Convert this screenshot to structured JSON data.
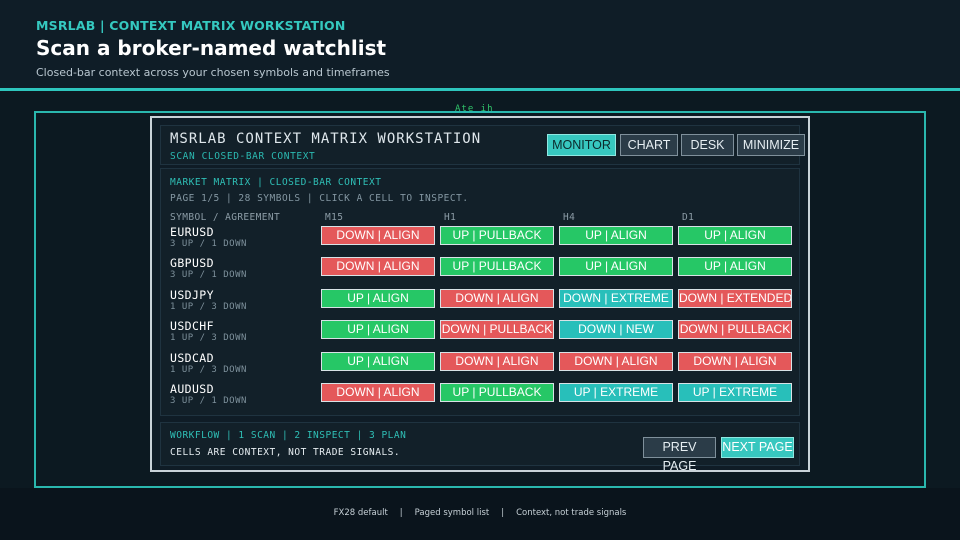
{
  "slide": {
    "brand": "MSRLAB  |  CONTEXT MATRIX WORKSTATION",
    "title": "Scan a broker-named watchlist",
    "subtitle": "Closed-bar context across your chosen symbols and timeframes",
    "ticker": "Ate ih"
  },
  "app": {
    "name": "MSRLAB  CONTEXT MATRIX WORKSTATION",
    "subtitle": "SCAN CLOSED-BAR CONTEXT",
    "buttons": [
      {
        "label": "MONITOR",
        "active": true
      },
      {
        "label": "CHART",
        "active": false
      },
      {
        "label": "DESK",
        "active": false
      },
      {
        "label": "MINIMIZE",
        "active": false
      }
    ]
  },
  "matrix": {
    "heading": "MARKET MATRIX | CLOSED-BAR CONTEXT",
    "info": "PAGE 1/5 | 28 SYMBOLS | CLICK A CELL TO INSPECT.",
    "symbol_header": "SYMBOL / AGREEMENT",
    "timeframes": [
      "M15",
      "H1",
      "H4",
      "D1"
    ],
    "rows": [
      {
        "symbol": "EURUSD",
        "agreement": "3 UP / 1 DOWN",
        "cells": [
          {
            "text": "DOWN | ALIGN",
            "color": "red"
          },
          {
            "text": "UP | PULLBACK",
            "color": "green"
          },
          {
            "text": "UP | ALIGN",
            "color": "green"
          },
          {
            "text": "UP | ALIGN",
            "color": "green"
          }
        ]
      },
      {
        "symbol": "GBPUSD",
        "agreement": "3 UP / 1 DOWN",
        "cells": [
          {
            "text": "DOWN | ALIGN",
            "color": "red"
          },
          {
            "text": "UP | PULLBACK",
            "color": "green"
          },
          {
            "text": "UP | ALIGN",
            "color": "green"
          },
          {
            "text": "UP | ALIGN",
            "color": "green"
          }
        ]
      },
      {
        "symbol": "USDJPY",
        "agreement": "1 UP / 3 DOWN",
        "cells": [
          {
            "text": "UP | ALIGN",
            "color": "green"
          },
          {
            "text": "DOWN | ALIGN",
            "color": "red"
          },
          {
            "text": "DOWN | EXTREME",
            "color": "teal"
          },
          {
            "text": "DOWN | EXTENDED",
            "color": "red"
          }
        ]
      },
      {
        "symbol": "USDCHF",
        "agreement": "1 UP / 3 DOWN",
        "cells": [
          {
            "text": "UP | ALIGN",
            "color": "green"
          },
          {
            "text": "DOWN | PULLBACK",
            "color": "red"
          },
          {
            "text": "DOWN | NEW",
            "color": "teal"
          },
          {
            "text": "DOWN | PULLBACK",
            "color": "red"
          }
        ]
      },
      {
        "symbol": "USDCAD",
        "agreement": "1 UP / 3 DOWN",
        "cells": [
          {
            "text": "UP | ALIGN",
            "color": "green"
          },
          {
            "text": "DOWN | ALIGN",
            "color": "red"
          },
          {
            "text": "DOWN | ALIGN",
            "color": "red"
          },
          {
            "text": "DOWN | ALIGN",
            "color": "red"
          }
        ]
      },
      {
        "symbol": "AUDUSD",
        "agreement": "3 UP / 1 DOWN",
        "cells": [
          {
            "text": "DOWN | ALIGN",
            "color": "red"
          },
          {
            "text": "UP | PULLBACK",
            "color": "green"
          },
          {
            "text": "UP | EXTREME",
            "color": "teal"
          },
          {
            "text": "UP | EXTREME",
            "color": "teal"
          }
        ]
      }
    ]
  },
  "footer": {
    "workflow": "WORKFLOW | 1 SCAN | 2 INSPECT | 3 PLAN",
    "note": "CELLS ARE CONTEXT, NOT TRADE SIGNALS.",
    "prev_label": "PREV PAGE",
    "next_label": "NEXT PAGE"
  },
  "caption": [
    "FX28 default",
    "Paged symbol list",
    "Context, not trade signals"
  ],
  "colors": {
    "accent_teal": "#2ec6bd",
    "cell_red": "#e4585a",
    "cell_green": "#26c766",
    "cell_teal": "#28bfba",
    "background": "#0a141c"
  }
}
